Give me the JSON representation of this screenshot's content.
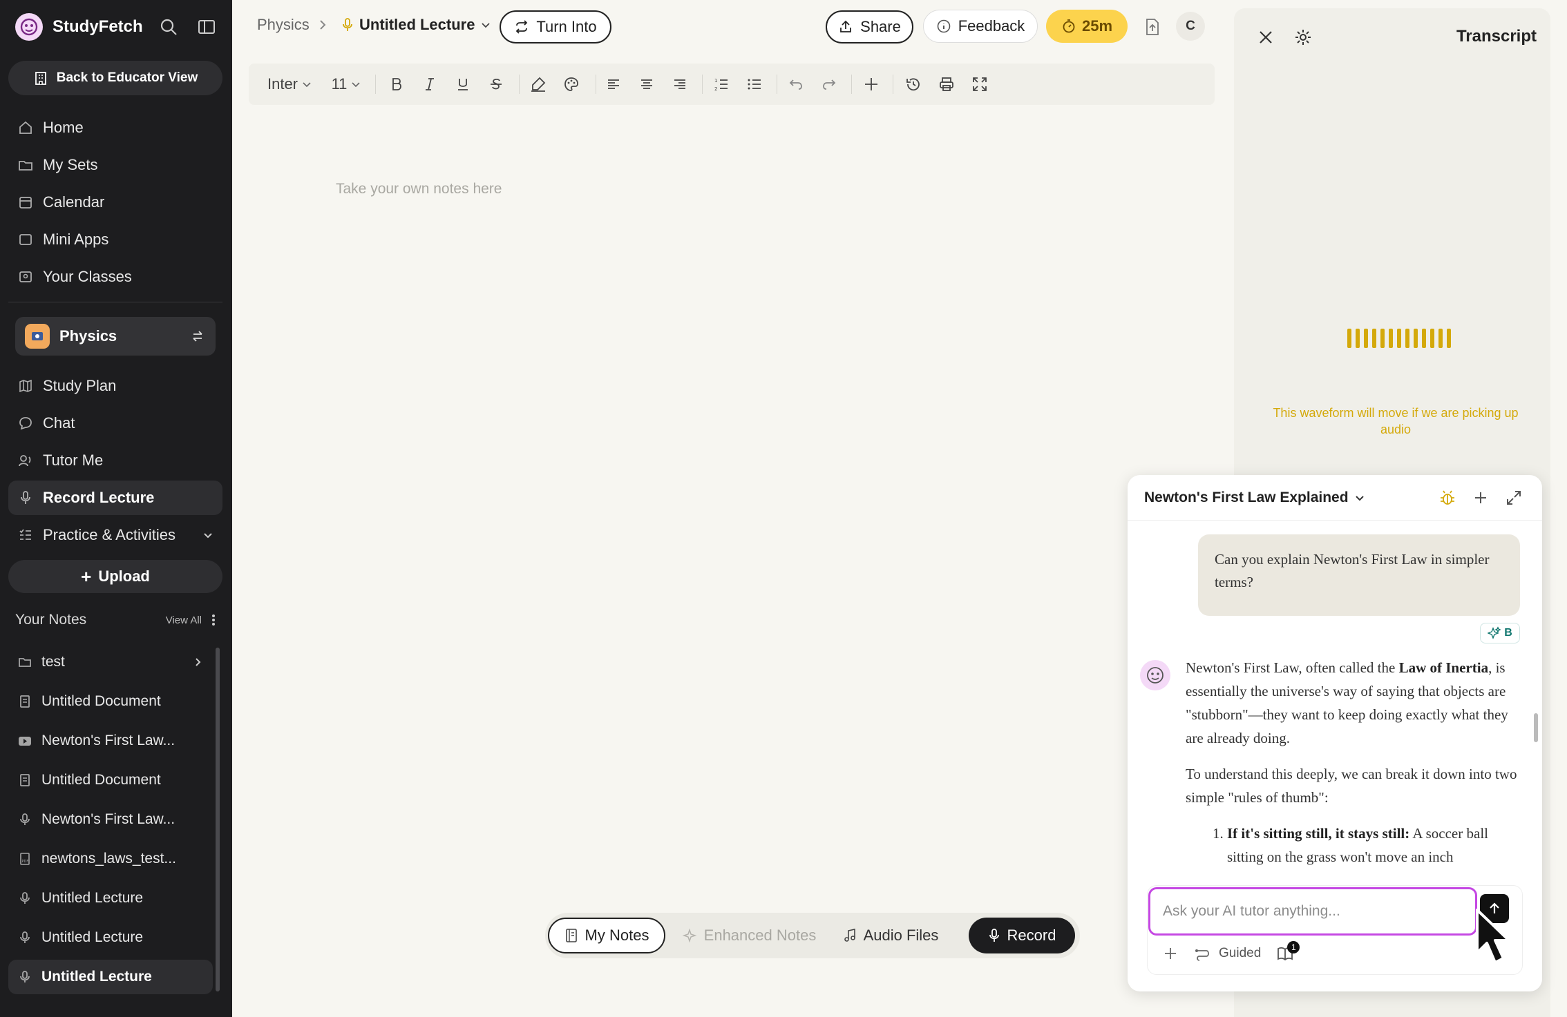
{
  "app": {
    "name": "StudyFetch",
    "educator_button": "Back to Educator View"
  },
  "sidebar": {
    "nav": [
      {
        "label": "Home",
        "icon": "home-icon"
      },
      {
        "label": "My Sets",
        "icon": "folder-icon"
      },
      {
        "label": "Calendar",
        "icon": "calendar-icon"
      },
      {
        "label": "Mini Apps",
        "icon": "app-window-icon"
      },
      {
        "label": "Your Classes",
        "icon": "classes-icon"
      }
    ],
    "class_name": "Physics",
    "class_nav": [
      {
        "label": "Study Plan",
        "icon": "map-icon"
      },
      {
        "label": "Chat",
        "icon": "chat-bubble-icon"
      },
      {
        "label": "Tutor Me",
        "icon": "tutor-icon"
      },
      {
        "label": "Record Lecture",
        "icon": "microphone-icon",
        "active": true
      },
      {
        "label": "Practice & Activities",
        "icon": "list-check-icon"
      }
    ],
    "upload_label": "Upload",
    "notes_title": "Your Notes",
    "view_all": "View All",
    "notes": [
      {
        "label": "test",
        "icon": "folder-icon"
      },
      {
        "label": "Untitled Document",
        "icon": "document-icon"
      },
      {
        "label": "Newton's First Law...",
        "icon": "video-icon"
      },
      {
        "label": "Untitled Document",
        "icon": "document-icon"
      },
      {
        "label": "Newton's First Law...",
        "icon": "microphone-icon"
      },
      {
        "label": "newtons_laws_test...",
        "icon": "pdf-icon"
      },
      {
        "label": "Untitled Lecture",
        "icon": "microphone-icon"
      },
      {
        "label": "Untitled Lecture",
        "icon": "microphone-icon"
      },
      {
        "label": "Untitled Lecture",
        "icon": "microphone-icon",
        "active": true
      }
    ]
  },
  "header": {
    "breadcrumb_class": "Physics",
    "lecture_title": "Untitled Lecture",
    "turn_into": "Turn Into",
    "share": "Share",
    "feedback": "Feedback",
    "timer": "25m",
    "avatar_initial": "C"
  },
  "toolbar": {
    "font": "Inter",
    "size": "11"
  },
  "editor": {
    "placeholder": "Take your own notes here"
  },
  "modes": {
    "my_notes": "My Notes",
    "enhanced_notes": "Enhanced Notes",
    "audio_files": "Audio Files",
    "record": "Record"
  },
  "transcript": {
    "title": "Transcript",
    "waveform_note": "This waveform will move if we are picking up audio"
  },
  "chat": {
    "title": "Newton's First Law Explained",
    "user_message": "Can you explain Newton's First Law in simpler terms?",
    "model_badge": "B",
    "ai_p1_a": "Newton's First Law, often called the ",
    "ai_p1_bold": "Law of Inertia",
    "ai_p1_b": ", is essentially the universe's way of saying that objects are \"stubborn\"—they want to keep doing exactly what they are already doing.",
    "ai_p2": "To understand this deeply, we can break it down into two simple \"rules of thumb\":",
    "ai_li1_bold": "If it's sitting still, it stays still:",
    "ai_li1_text": " A soccer ball sitting on the grass won't move an inch",
    "input_placeholder": "Ask your AI tutor anything...",
    "guided_label": "Guided",
    "notes_badge": "1"
  },
  "colors": {
    "sidebar_bg": "#1d1d1f",
    "accent_yellow": "#fcd34d",
    "input_focus": "#c548e3",
    "waveform": "#d4a90a"
  }
}
